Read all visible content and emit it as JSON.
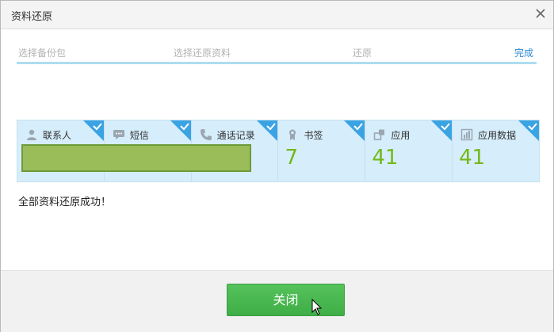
{
  "window": {
    "title": "资料还原",
    "close_icon": "close-icon"
  },
  "steps": [
    {
      "label": "选择备份包",
      "state": "done"
    },
    {
      "label": "选择还原资料",
      "state": "done"
    },
    {
      "label": "还原",
      "state": "done"
    },
    {
      "label": "完成",
      "state": "current"
    }
  ],
  "cards": [
    {
      "label": "联系人",
      "icon": "person-icon",
      "value": "",
      "checked": true
    },
    {
      "label": "短信",
      "icon": "message-icon",
      "value": "",
      "checked": true
    },
    {
      "label": "通话记录",
      "icon": "phone-icon",
      "value": "",
      "checked": true
    },
    {
      "label": "书签",
      "icon": "bookmark-icon",
      "value": "7",
      "checked": true
    },
    {
      "label": "应用",
      "icon": "app-icon",
      "value": "41",
      "checked": true
    },
    {
      "label": "应用数据",
      "icon": "app-data-icon",
      "value": "41",
      "checked": true
    }
  ],
  "status": {
    "message": "全部资料还原成功！"
  },
  "footer": {
    "close_label": "关闭"
  },
  "colors": {
    "accent_blue": "#2a8ad3",
    "card_bg": "#d6edfb",
    "value_green": "#74b81a",
    "button_green": "#4cb953"
  }
}
